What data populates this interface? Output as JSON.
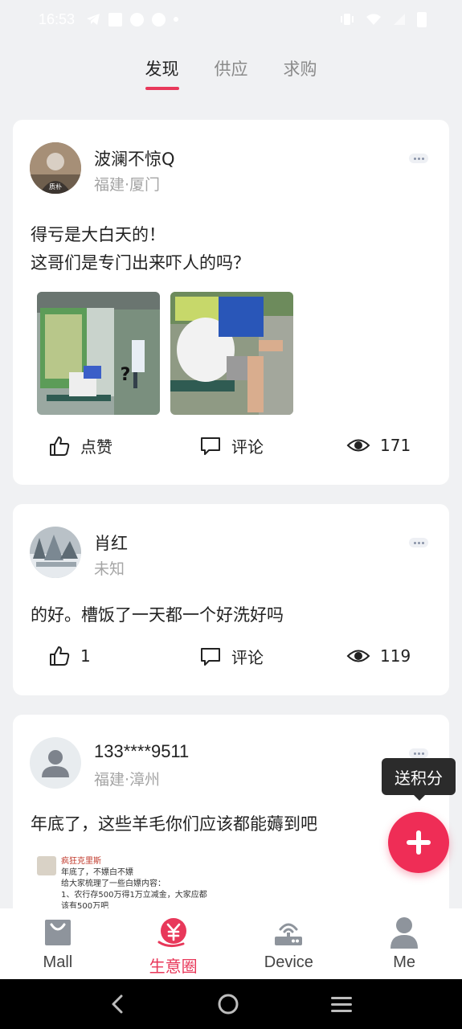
{
  "status_bar": {
    "time": "16:53"
  },
  "tabs": [
    {
      "label": "发现",
      "active": true
    },
    {
      "label": "供应",
      "active": false
    },
    {
      "label": "求购",
      "active": false
    }
  ],
  "posts": [
    {
      "username": "波澜不惊Q",
      "location": "福建·厦门",
      "avatar_text": "质朴",
      "text_lines": [
        "得亏是大白天的！",
        "这哥们是专门出来吓人的吗？"
      ],
      "actions": {
        "like": "点赞",
        "comment": "评论",
        "views": "171"
      }
    },
    {
      "username": "肖红",
      "location": "未知",
      "text_lines": [
        "的好。槽饭了一天都一个好洗好吗"
      ],
      "actions": {
        "like": "1",
        "comment": "评论",
        "views": "119"
      }
    },
    {
      "username": "133****9511",
      "location": "福建·漳州",
      "text_lines": [
        "年底了，这些羊毛你们应该都能薅到吧"
      ],
      "preview": {
        "author": "疯狂克里斯",
        "lines": [
          "年底了，不嫖白不嫖",
          "给大家梳理了一些白嫖内容：",
          "1、农行存500万得1万立减金，大家应都",
          "该有500万吧"
        ]
      }
    }
  ],
  "fab": {
    "tooltip": "送积分"
  },
  "bottom_nav": [
    {
      "label": "Mall",
      "active": false
    },
    {
      "label": "生意圈",
      "active": true
    },
    {
      "label": "Device",
      "active": false
    },
    {
      "label": "Me",
      "active": false
    }
  ],
  "colors": {
    "accent": "#e8385a",
    "fab": "#ef2d56"
  }
}
